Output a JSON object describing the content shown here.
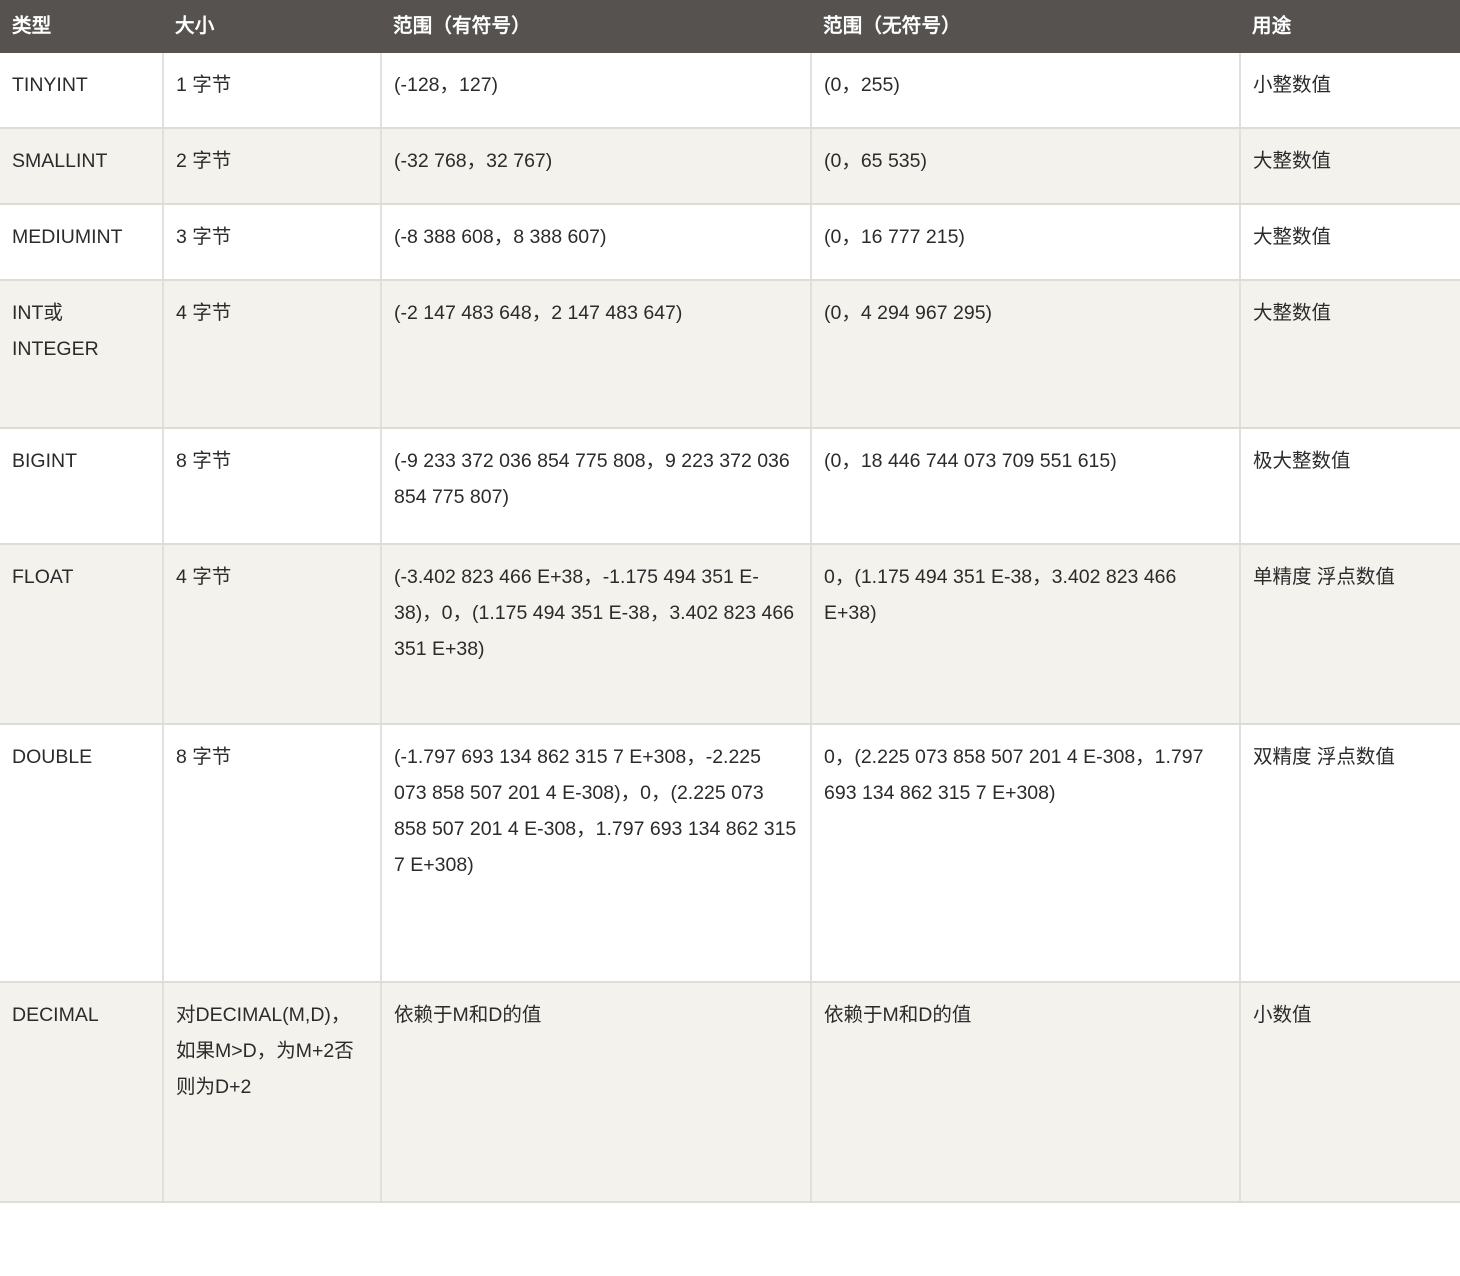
{
  "table": {
    "headers": [
      {
        "key": "type",
        "label": "类型"
      },
      {
        "key": "size",
        "label": "大小"
      },
      {
        "key": "signed",
        "label": "范围（有符号）"
      },
      {
        "key": "unsigned",
        "label": "范围（无符号）"
      },
      {
        "key": "use",
        "label": "用途"
      }
    ],
    "rows": [
      {
        "type": "TINYINT",
        "size": "1 字节",
        "signed": "(-128，127)",
        "unsigned": "(0，255)",
        "use": "小整数值"
      },
      {
        "type": "SMALLINT",
        "size": "2 字节",
        "signed": "(-32 768，32 767)",
        "unsigned": "(0，65 535)",
        "use": "大整数值"
      },
      {
        "type": "MEDIUMINT",
        "size": "3 字节",
        "signed": "(-8 388 608，8 388 607)",
        "unsigned": "(0，16 777 215)",
        "use": "大整数值"
      },
      {
        "type": "INT或 INTEGER",
        "size": "4 字节",
        "signed": "(-2 147 483 648，2 147 483 647)",
        "unsigned": "(0，4 294 967 295)",
        "use": "大整数值"
      },
      {
        "type": "BIGINT",
        "size": "8 字节",
        "signed": "(-9 233 372 036 854 775 808，9 223 372 036 854 775 807)",
        "unsigned": "(0，18 446 744 073 709 551 615)",
        "use": "极大整数值"
      },
      {
        "type": "FLOAT",
        "size": "4 字节",
        "signed": "(-3.402 823 466 E+38，-1.175 494 351 E-38)，0，(1.175 494 351 E-38，3.402 823 466 351 E+38)",
        "unsigned": "0，(1.175 494 351 E-38，3.402 823 466 E+38)",
        "use": "单精度 浮点数值"
      },
      {
        "type": "DOUBLE",
        "size": "8 字节",
        "signed": "(-1.797 693 134 862 315 7 E+308，-2.225 073 858 507 201 4 E-308)，0，(2.225 073 858 507 201 4 E-308，1.797 693 134 862 315 7 E+308)",
        "unsigned": "0，(2.225 073 858 507 201 4 E-308，1.797 693 134 862 315 7 E+308)",
        "use": "双精度 浮点数值"
      },
      {
        "type": "DECIMAL",
        "size": "对DECIMAL(M,D)，如果M>D，为M+2否则为D+2",
        "signed": "依赖于M和D的值",
        "unsigned": "依赖于M和D的值",
        "use": "小数值"
      }
    ]
  },
  "colors": {
    "header_background": "#55524f",
    "header_text": "#ffffff",
    "row_odd_background": "#ffffff",
    "row_even_background": "#f4f2ed",
    "cell_border": "#e2e0db",
    "body_text": "#2b2b2b"
  }
}
